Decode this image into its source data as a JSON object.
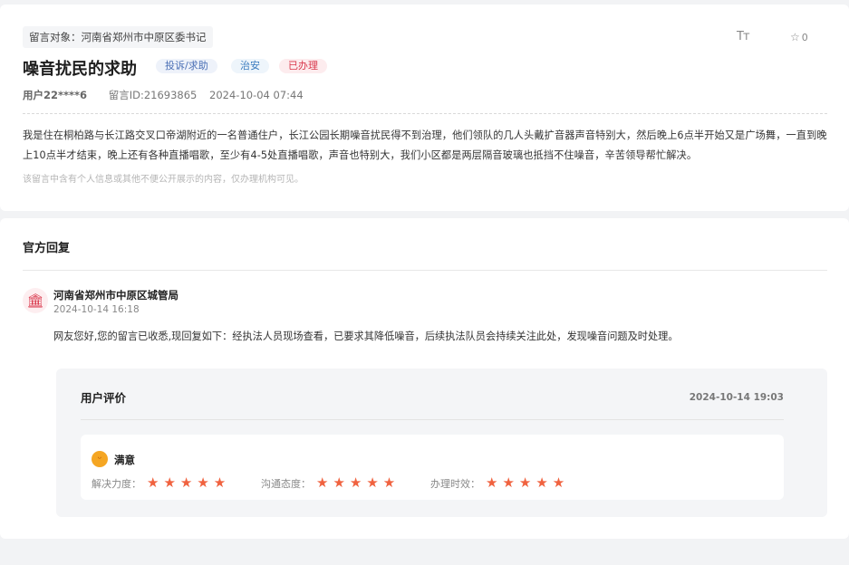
{
  "post": {
    "target": "留言对象：河南省郑州市中原区委书记",
    "font_toggle": "Tт",
    "fav_count": "0",
    "title": "噪音扰民的求助",
    "tags": {
      "type": "投诉/求助",
      "category": "治安",
      "status": "已办理"
    },
    "user": "用户22****6",
    "id": "留言ID:21693865",
    "time": "2024-10-04 07:44",
    "content": "我是住在桐柏路与长江路交叉口帝湖附近的一名普通住户，长江公园长期噪音扰民得不到治理，他们领队的几人头戴扩音器声音特别大，然后晚上6点半开始又是广场舞，一直到晚上10点半才结束，晚上还有各种直播唱歌，至少有4-5处直播唱歌，声音也特别大，我们小区都是两层隔音玻璃也抵挡不住噪音，辛苦领导帮忙解决。",
    "notice": "该留言中含有个人信息或其他不便公开展示的内容，仅办理机构可见。"
  },
  "reply": {
    "heading": "官方回复",
    "dept_icon": "🏛",
    "dept": "河南省郑州市中原区城管局",
    "time": "2024-10-14 16:18",
    "text": "网友您好,您的留言已收悉,现回复如下：经执法人员现场查看，已要求其降低噪音，后续执法队员会持续关注此处，发现噪音问题及时处理。"
  },
  "evaluation": {
    "title": "用户评价",
    "time": "2024-10-14 19:03",
    "satisfaction": "满意",
    "ratings": [
      {
        "label": "解决力度：",
        "stars": "★★★★★",
        "score": 5
      },
      {
        "label": "沟通态度：",
        "stars": "★★★★★",
        "score": 5
      },
      {
        "label": "办理时效：",
        "stars": "★★★★★",
        "score": 5
      }
    ]
  },
  "colors": {
    "accent_red": "#d9374b",
    "star": "#f0623f",
    "tag_blue": "#4a6fb5"
  },
  "icons": {
    "font_toggle": "font-size-icon",
    "favorite": "star-outline-icon",
    "department": "government-building-icon",
    "satisfaction": "smile-icon",
    "rating": "star-icon"
  }
}
